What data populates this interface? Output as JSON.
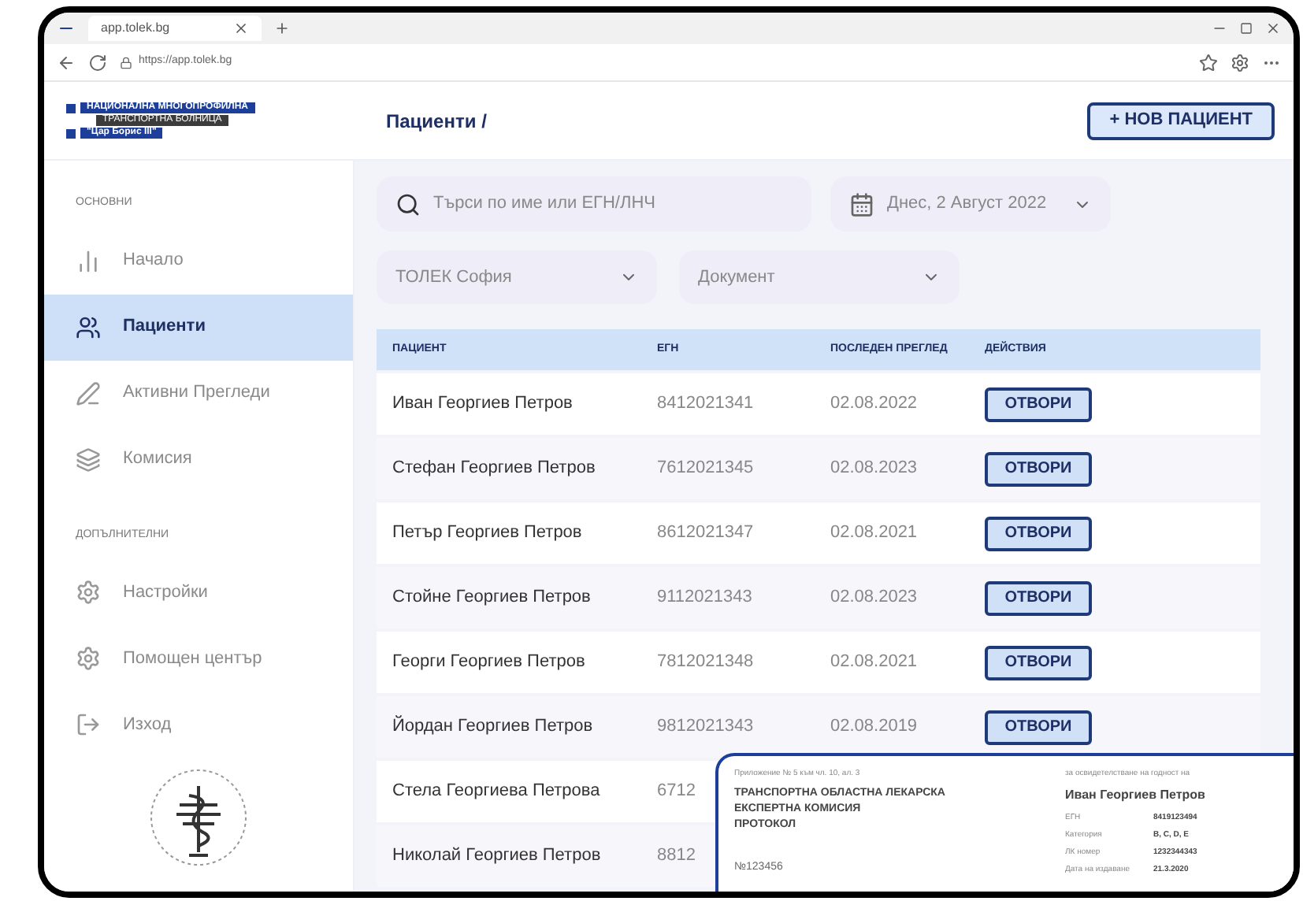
{
  "browser": {
    "tab_title": "app.tolek.bg",
    "url": "https://app.tolek.bg"
  },
  "logo": {
    "lines": [
      "НАЦИОНАЛНА МНОГОПРОФИЛНА",
      "ТРАНСПОРТНА БОЛНИЦА",
      "\"Цар Борис III\""
    ]
  },
  "header": {
    "breadcrumb": "Пациенти /",
    "new_button": "+ НОВ ПАЦИЕНТ"
  },
  "sidebar": {
    "sections": [
      {
        "title": "ОСНОВНИ",
        "items": [
          {
            "label": "Начало",
            "selected": false
          },
          {
            "label": "Пациенти",
            "selected": true
          },
          {
            "label": "Активни Прегледи",
            "selected": false
          },
          {
            "label": "Комисия",
            "selected": false
          }
        ]
      },
      {
        "title": "ДОПЪЛНИТЕЛНИ",
        "items": [
          {
            "label": "Настройки",
            "selected": false
          },
          {
            "label": "Помощен център",
            "selected": false
          },
          {
            "label": "Изход",
            "selected": false
          }
        ]
      }
    ]
  },
  "filters": {
    "search": {
      "placeholder": "Търси по име или ЕГН/ЛНЧ"
    },
    "date": "Днес, 2 Август 2022",
    "branch": "ТОЛЕК София",
    "document": "Документ"
  },
  "table": {
    "columns": [
      "ПАЦИЕНТ",
      "ЕГН",
      "ПОСЛЕДЕН ПРЕГЛЕД",
      "ДЕЙСТВИЯ"
    ],
    "rows": [
      {
        "patient": "Иван Георгиев Петров",
        "egn": "8412021341",
        "last_exam": "02.08.2022",
        "action": "ОТВОРИ"
      },
      {
        "patient": "Стефан Георгиев Петров",
        "egn": "7612021345",
        "last_exam": "02.08.2023",
        "action": "ОТВОРИ"
      },
      {
        "patient": "Петър Георгиев Петров",
        "egn": "8612021347",
        "last_exam": "02.08.2021",
        "action": "ОТВОРИ"
      },
      {
        "patient": "Стойне Георгиев Петров",
        "egn": "9112021343",
        "last_exam": "02.08.2023",
        "action": "ОТВОРИ"
      },
      {
        "patient": "Георги Георгиев Петров",
        "egn": "7812021348",
        "last_exam": "02.08.2021",
        "action": "ОТВОРИ"
      },
      {
        "patient": "Йордан Георгиев Петров",
        "egn": "9812021343",
        "last_exam": "02.08.2019",
        "action": "ОТВОРИ"
      },
      {
        "patient": "Стела Георгиева Петрова",
        "egn": "6712"
      },
      {
        "patient": "Николай Георгиев Петров",
        "egn": "8812"
      }
    ]
  },
  "document_preview": {
    "annex": "Приложение № 5 към чл. 10, ал. 3",
    "title_lines": [
      "ТРАНСПОРТНА ОБЛАСТНА ЛЕКАРСКА",
      "ЕКСПЕРТНА КОМИСИЯ",
      "ПРОТОКОЛ"
    ],
    "number": "№123456",
    "subject_label": "за освидетелстване на годност на",
    "subject_name": "Иван Георгиев Петров",
    "fields": [
      {
        "label": "ЕГН",
        "value": "8419123494"
      },
      {
        "label": "Категория",
        "value": "B, C, D, E"
      },
      {
        "label": "ЛК номер",
        "value": "1232344343"
      },
      {
        "label": "Дата на издаване",
        "value": "21.3.2020"
      }
    ]
  }
}
